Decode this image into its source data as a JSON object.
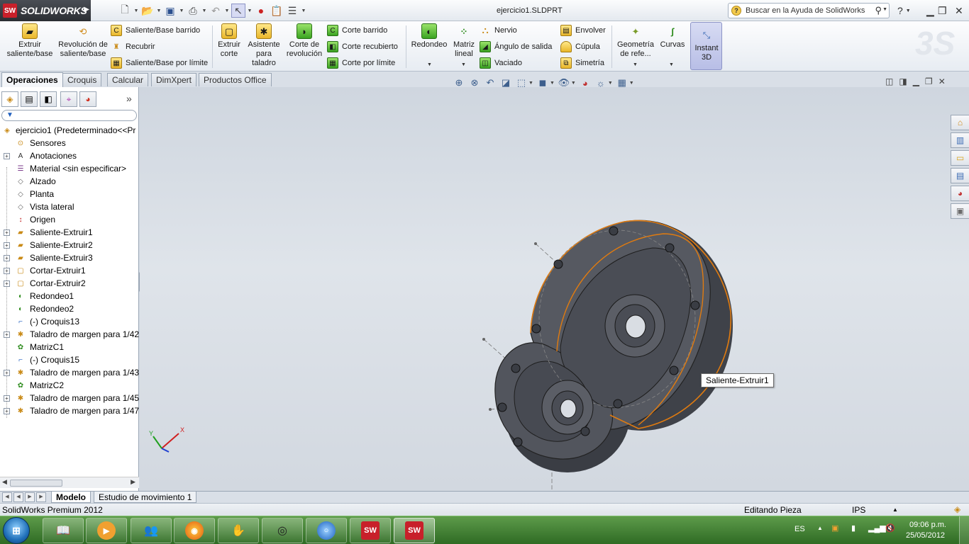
{
  "app": {
    "brand": "SOLIDWORKS",
    "logo_mark": "SW",
    "document_title": "ejercicio1.SLDPRT",
    "help_search_placeholder": "Buscar en la Ayuda de SolidWorks",
    "help_icon": "?"
  },
  "command_manager": {
    "extrude_boss": "Extruir saliente/base",
    "revolve_boss": "Revolución de saliente/base",
    "swept_boss": "Saliente/Base barrido",
    "loft_boss": "Recubrir",
    "boundary_boss": "Saliente/Base por límite",
    "extrude_cut": "Extruir corte",
    "hole_wizard": "Asistente para taladro",
    "revolve_cut": "Corte de revolución",
    "swept_cut": "Corte barrido",
    "loft_cut": "Corte recubierto",
    "boundary_cut": "Corte por límite",
    "fillet": "Redondeo",
    "linear_pattern": "Matriz lineal",
    "rib": "Nervio",
    "draft": "Ángulo de salida",
    "shell": "Vaciado",
    "wrap": "Envolver",
    "dome": "Cúpula",
    "mirror": "Simetría",
    "ref_geometry": "Geometría de refe...",
    "curves": "Curvas",
    "instant3d": "Instant 3D"
  },
  "tabs": [
    "Operaciones",
    "Croquis",
    "Calcular",
    "DimXpert",
    "Productos Office"
  ],
  "active_tab": "Operaciones",
  "feature_tree": {
    "root": "ejercicio1  (Predeterminado<<Pr",
    "items": [
      {
        "label": "Sensores",
        "icon": "sensor-icon",
        "expandable": false
      },
      {
        "label": "Anotaciones",
        "icon": "annotation-icon",
        "expandable": true
      },
      {
        "label": "Material <sin especificar>",
        "icon": "material-icon",
        "expandable": false
      },
      {
        "label": "Alzado",
        "icon": "plane-icon",
        "expandable": false
      },
      {
        "label": "Planta",
        "icon": "plane-icon",
        "expandable": false
      },
      {
        "label": "Vista lateral",
        "icon": "plane-icon",
        "expandable": false
      },
      {
        "label": "Origen",
        "icon": "origin-icon",
        "expandable": false
      },
      {
        "label": "Saliente-Extruir1",
        "icon": "extrude-boss-icon",
        "expandable": true
      },
      {
        "label": "Saliente-Extruir2",
        "icon": "extrude-boss-icon",
        "expandable": true
      },
      {
        "label": "Saliente-Extruir3",
        "icon": "extrude-boss-icon",
        "expandable": true
      },
      {
        "label": "Cortar-Extruir1",
        "icon": "extrude-cut-icon",
        "expandable": true
      },
      {
        "label": "Cortar-Extruir2",
        "icon": "extrude-cut-icon",
        "expandable": true
      },
      {
        "label": "Redondeo1",
        "icon": "fillet-icon",
        "expandable": false
      },
      {
        "label": "Redondeo2",
        "icon": "fillet-icon",
        "expandable": false
      },
      {
        "label": "(-) Croquis13",
        "icon": "sketch-icon",
        "expandable": false
      },
      {
        "label": "Taladro de margen para 1/42",
        "icon": "hole-icon",
        "expandable": true
      },
      {
        "label": "MatrizC1",
        "icon": "pattern-icon",
        "expandable": false
      },
      {
        "label": "(-) Croquis15",
        "icon": "sketch-icon",
        "expandable": false
      },
      {
        "label": "Taladro de margen para 1/43",
        "icon": "hole-icon",
        "expandable": true
      },
      {
        "label": "MatrizC2",
        "icon": "pattern-icon",
        "expandable": false
      },
      {
        "label": "Taladro de margen para 1/45",
        "icon": "hole-icon",
        "expandable": true
      },
      {
        "label": "Taladro de margen para 1/47",
        "icon": "hole-icon",
        "expandable": true
      }
    ]
  },
  "viewport": {
    "tooltip": "Saliente-Extruir1",
    "triad_x": "X",
    "triad_y": "Y"
  },
  "bottom_tabs": [
    "Modelo",
    "Estudio de movimiento 1"
  ],
  "active_bottom_tab": "Modelo",
  "status": {
    "product": "SolidWorks Premium 2012",
    "mode": "Editando Pieza",
    "units": "IPS"
  },
  "tray": {
    "language": "ES",
    "time": "09:06 p.m.",
    "date": "25/05/2012"
  },
  "colors": {
    "model_face": "#4d5058",
    "selection_edge": "#e07b10",
    "titlebar_logo": "#c8202a",
    "taskbar": "#3f7f31"
  }
}
